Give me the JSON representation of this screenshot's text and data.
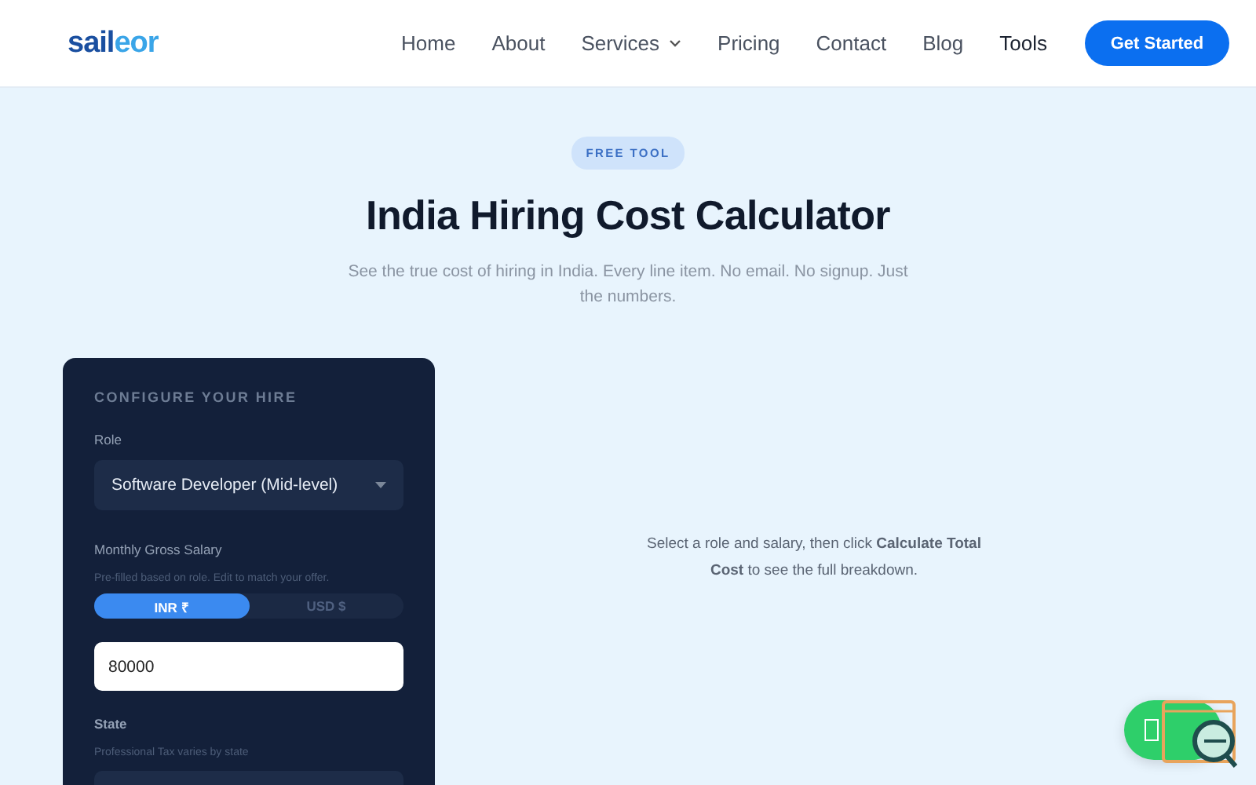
{
  "header": {
    "logo": {
      "part_1": "sail",
      "part_2": "eor"
    },
    "nav": [
      {
        "label": "Home",
        "selected": false,
        "dropdown": false
      },
      {
        "label": "About",
        "selected": false,
        "dropdown": false
      },
      {
        "label": "Services",
        "selected": false,
        "dropdown": true
      },
      {
        "label": "Pricing",
        "selected": false,
        "dropdown": false
      },
      {
        "label": "Contact",
        "selected": false,
        "dropdown": false
      },
      {
        "label": "Blog",
        "selected": false,
        "dropdown": false
      },
      {
        "label": "Tools",
        "selected": true,
        "dropdown": false
      }
    ],
    "cta": "Get Started"
  },
  "hero": {
    "badge": "FREE TOOL",
    "title": "India Hiring Cost Calculator",
    "subtitle": "See the true cost of hiring in India. Every line item. No email. No signup. Just the numbers."
  },
  "config": {
    "heading": "CONFIGURE YOUR HIRE",
    "role": {
      "label": "Role",
      "value": "Software Developer (Mid-level)"
    },
    "salary": {
      "label": "Monthly Gross Salary",
      "hint": "Pre-filled based on role. Edit to match your offer.",
      "currencies": [
        {
          "label": "INR ₹",
          "selected": true
        },
        {
          "label": "USD $",
          "selected": false
        }
      ],
      "value": "80000"
    },
    "state": {
      "label": "State",
      "hint": "Professional Tax varies by state"
    }
  },
  "result": {
    "message": "Select a role and salary, then click **Calculate Total Cost** to see the full breakdown."
  }
}
